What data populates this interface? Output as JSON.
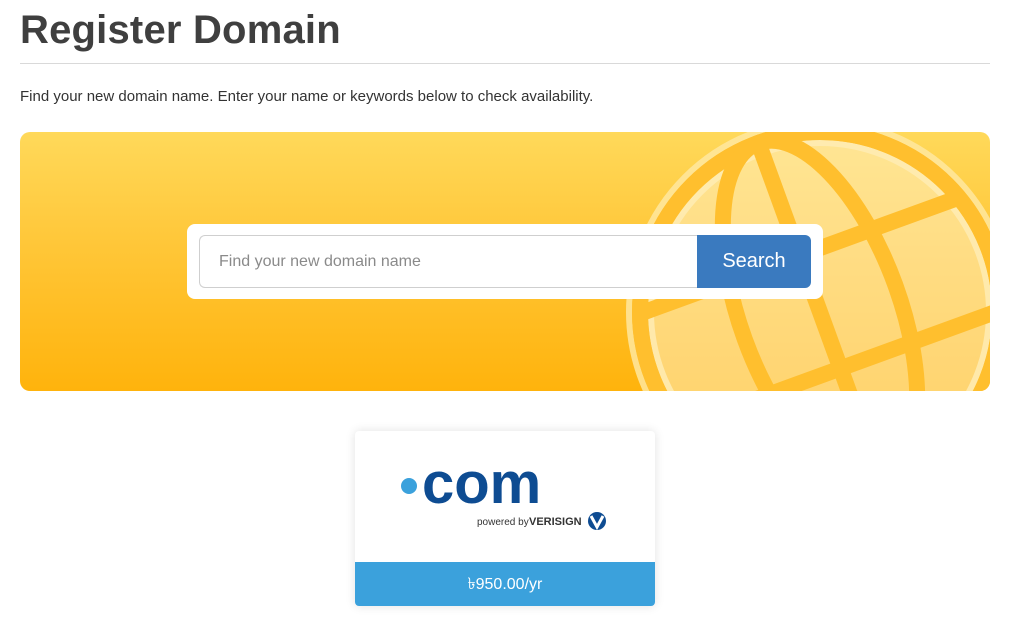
{
  "page": {
    "title": "Register Domain",
    "intro": "Find your new domain name. Enter your name or keywords below to check availability."
  },
  "search": {
    "placeholder": "Find your new domain name",
    "value": "",
    "button_label": "Search"
  },
  "featured_tld": {
    "extension": "com",
    "powered_by": "powered by",
    "brand": "VERISIGN",
    "price": "৳950.00/yr"
  },
  "colors": {
    "hero_top": "#ffd95a",
    "hero_bottom": "#ffb30c",
    "search_button": "#3a7abf",
    "price_bar": "#3ba1dc",
    "com_logo": "#0e4c92",
    "com_dot": "#3ba1dc"
  },
  "icons": {
    "hero_decoration": "globe-icon",
    "verisign_badge": "verisign-check-icon"
  }
}
